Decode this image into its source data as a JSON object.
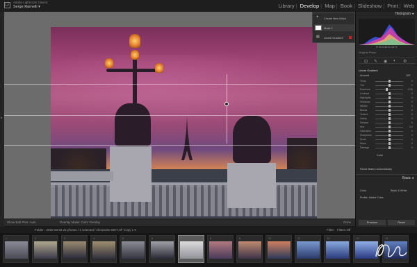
{
  "topbar": {
    "catalog_line": "Adobe Lightroom Classic",
    "user_name": "Serge Ramelli ▾",
    "modules": [
      "Library",
      "Develop",
      "Map",
      "Book",
      "Slideshow",
      "Print",
      "Web"
    ],
    "active_module": "Develop"
  },
  "mask_panel": {
    "row1": "Create New Mask",
    "row2": "Mask 1",
    "row3": "Linear Gradient"
  },
  "right_panel": {
    "histogram_label": "Histogram ◂",
    "histogram_info": "R 93  G 80  B 102 %",
    "original_photo": "Original Photo",
    "mask_section": "Linear Gradient",
    "amount_label": "Amount",
    "amount_value": "100",
    "sliders": [
      {
        "label": "Temp",
        "pos": 0.5,
        "value": "0"
      },
      {
        "label": "Tint",
        "pos": 0.5,
        "value": "0"
      },
      {
        "label": "Exposure",
        "pos": 0.42,
        "value": "-0.50"
      },
      {
        "label": "Contrast",
        "pos": 0.5,
        "value": "0"
      },
      {
        "label": "Highlights",
        "pos": 0.5,
        "value": "0"
      },
      {
        "label": "Shadows",
        "pos": 0.5,
        "value": "0"
      },
      {
        "label": "Whites",
        "pos": 0.5,
        "value": "0"
      },
      {
        "label": "Blacks",
        "pos": 0.5,
        "value": "0"
      },
      {
        "label": "Texture",
        "pos": 0.5,
        "value": "0"
      },
      {
        "label": "Clarity",
        "pos": 0.5,
        "value": "0"
      },
      {
        "label": "Dehaze",
        "pos": 0.5,
        "value": "0"
      },
      {
        "label": "Hue",
        "pos": 0.5,
        "value": "0.0"
      },
      {
        "label": "Saturation",
        "pos": 0.5,
        "value": "0"
      },
      {
        "label": "Sharpness",
        "pos": 0.5,
        "value": "0"
      },
      {
        "label": "Noise",
        "pos": 0.5,
        "value": "0"
      },
      {
        "label": "Moire",
        "pos": 0.5,
        "value": "0"
      },
      {
        "label": "Defringe",
        "pos": 0.5,
        "value": "0"
      }
    ],
    "color_label": "Color",
    "reset_sliders": "Reset Sliders Automatically",
    "basic_label": "Basic ◂",
    "treatment_color": "Color",
    "treatment_bw": "Black & White",
    "profile_label": "Profile: Adobe Color",
    "previous_button": "Previous",
    "reset_button": "Reset"
  },
  "toolbar": {
    "show_edit_pins": "Show Edit Pins: Auto",
    "overlay_mode": "Overlay Mode: Color Overlay",
    "done": "Done"
  },
  "filmstrip": {
    "folder_info": "Folder : 2020-03-02   21 photos / 1 selected / Alexandre-8977.tif*   Copy 1 ▾",
    "filter_label": "Filter:",
    "filter_value": "Filters Off",
    "numbers": [
      "1",
      "2",
      "3",
      "4",
      "5",
      "6",
      "7",
      "8",
      "9",
      "10",
      "11",
      "12",
      "13",
      "14"
    ],
    "selected_index": 6
  },
  "colors": {
    "accent_active": "#f0f0f0",
    "mask_dot": "#cc2222"
  }
}
